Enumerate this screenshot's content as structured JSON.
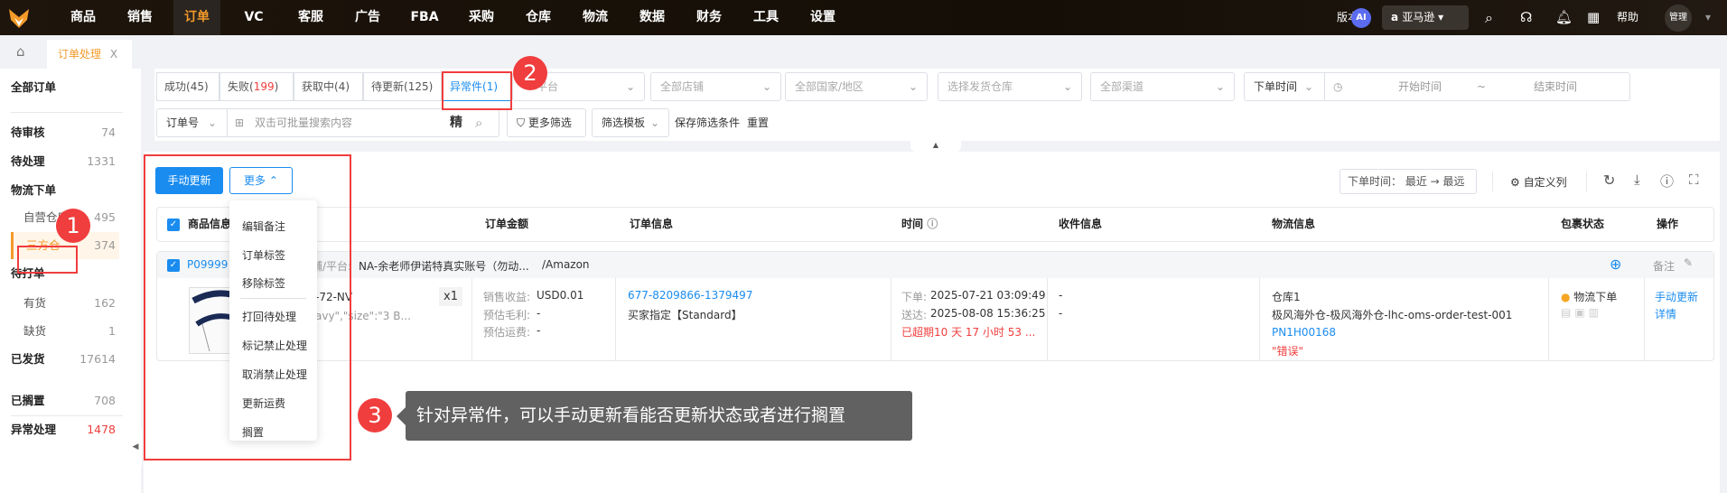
{
  "topnav": {
    "items": [
      "商品",
      "销售",
      "订单",
      "VC",
      "客服",
      "广告",
      "FBA",
      "采购",
      "仓库",
      "物流",
      "数据",
      "财务",
      "工具",
      "设置"
    ],
    "active": "订单",
    "version": "版本",
    "ai": "AI",
    "store": "亚马逊",
    "help": "帮助",
    "user": "管理"
  },
  "tabs": {
    "current": "订单处理",
    "close": "X"
  },
  "sidebar": {
    "items": [
      {
        "label": "全部订单",
        "count": ""
      },
      {
        "label": "待审核",
        "count": "74"
      },
      {
        "label": "待处理",
        "count": "1331"
      },
      {
        "label": "物流下单",
        "count": ""
      },
      {
        "label": "自营仓库",
        "count": "495"
      },
      {
        "label": "三方仓",
        "count": "374"
      },
      {
        "label": "待打单",
        "count": ""
      },
      {
        "label": "有货",
        "count": "162"
      },
      {
        "label": "缺货",
        "count": "1"
      },
      {
        "label": "已发货",
        "count": "17614"
      },
      {
        "label": "已搁置",
        "count": "708"
      },
      {
        "label": "异常处理",
        "count": "1478"
      }
    ]
  },
  "filters": {
    "status_tabs": [
      {
        "label": "成功(",
        "count": "45"
      },
      {
        "label": "失败(",
        "count": "199"
      },
      {
        "label": "获取中(",
        "count": "4"
      },
      {
        "label": "待更新(",
        "count": "125"
      },
      {
        "label": "异常件(",
        "count": "1"
      }
    ],
    "platform": "平台",
    "shop": "全部店铺",
    "country": "全部国家/地区",
    "warehouse": "选择发货仓库",
    "channel": "全部渠道",
    "time_type": "下单时间",
    "start": "开始时间",
    "tilde": "~",
    "end": "结束时间",
    "search_type": "订单号",
    "search_placeholder": "双击可批量搜索内容",
    "exact": "精",
    "more_filter": "更多筛选",
    "template": "筛选模板",
    "save": "保存筛选条件",
    "reset": "重置"
  },
  "toolbar": {
    "manual_update": "手动更新",
    "more": "更多",
    "sort": "下单时间： 最近 → 最远",
    "custom_cols": "自定义列"
  },
  "menu": {
    "items": [
      "编辑备注",
      "订单标签",
      "移除标签",
      "打回待处理",
      "标记禁止处理",
      "取消禁止处理",
      "更新运费",
      "搁置"
    ]
  },
  "table": {
    "headers": [
      "商品信息",
      "订单金额",
      "订单信息",
      "时间",
      "收件信息",
      "物流信息",
      "包裹状态",
      "操作"
    ],
    "order": {
      "id": "P09999",
      "shop_label": "店铺/平台:",
      "shop": "NA-余老师伊诺特真实账号（勿动...",
      "platform": "/Amazon",
      "note": "备注",
      "sku": "-72-NV",
      "attrs": "avy\",\"size\":\"3 B...",
      "qty": "x1",
      "revenue_label": "销售收益:",
      "revenue": "USD0.01",
      "profit_label": "预估毛利:",
      "profit": "-",
      "shipping_label": "预估运费:",
      "shipping": "-",
      "order_no": "677-8209866-1379497",
      "buyer_ship": "买家指定【Standard】",
      "ordered_label": "下单:",
      "ordered": "2025-07-21 03:09:49",
      "deliver_label": "送达:",
      "deliver": "2025-08-08 15:36:25",
      "overdue": "已超期10 天 17 小时 53 ...",
      "recv1": "-",
      "recv2": "-",
      "wh": "仓库1",
      "logistics": "极风海外仓-极风海外仓-lhc-oms-order-test-001",
      "tracking": "PN1H00168",
      "error": "\"错误\"",
      "pkg_status": "物流下单",
      "actions": [
        "手动更新",
        "详情"
      ]
    }
  },
  "annotations": {
    "n1": "1",
    "n2": "2",
    "n3": "3",
    "tip": "针对异常件，可以手动更新看能否更新状态或者进行搁置"
  }
}
